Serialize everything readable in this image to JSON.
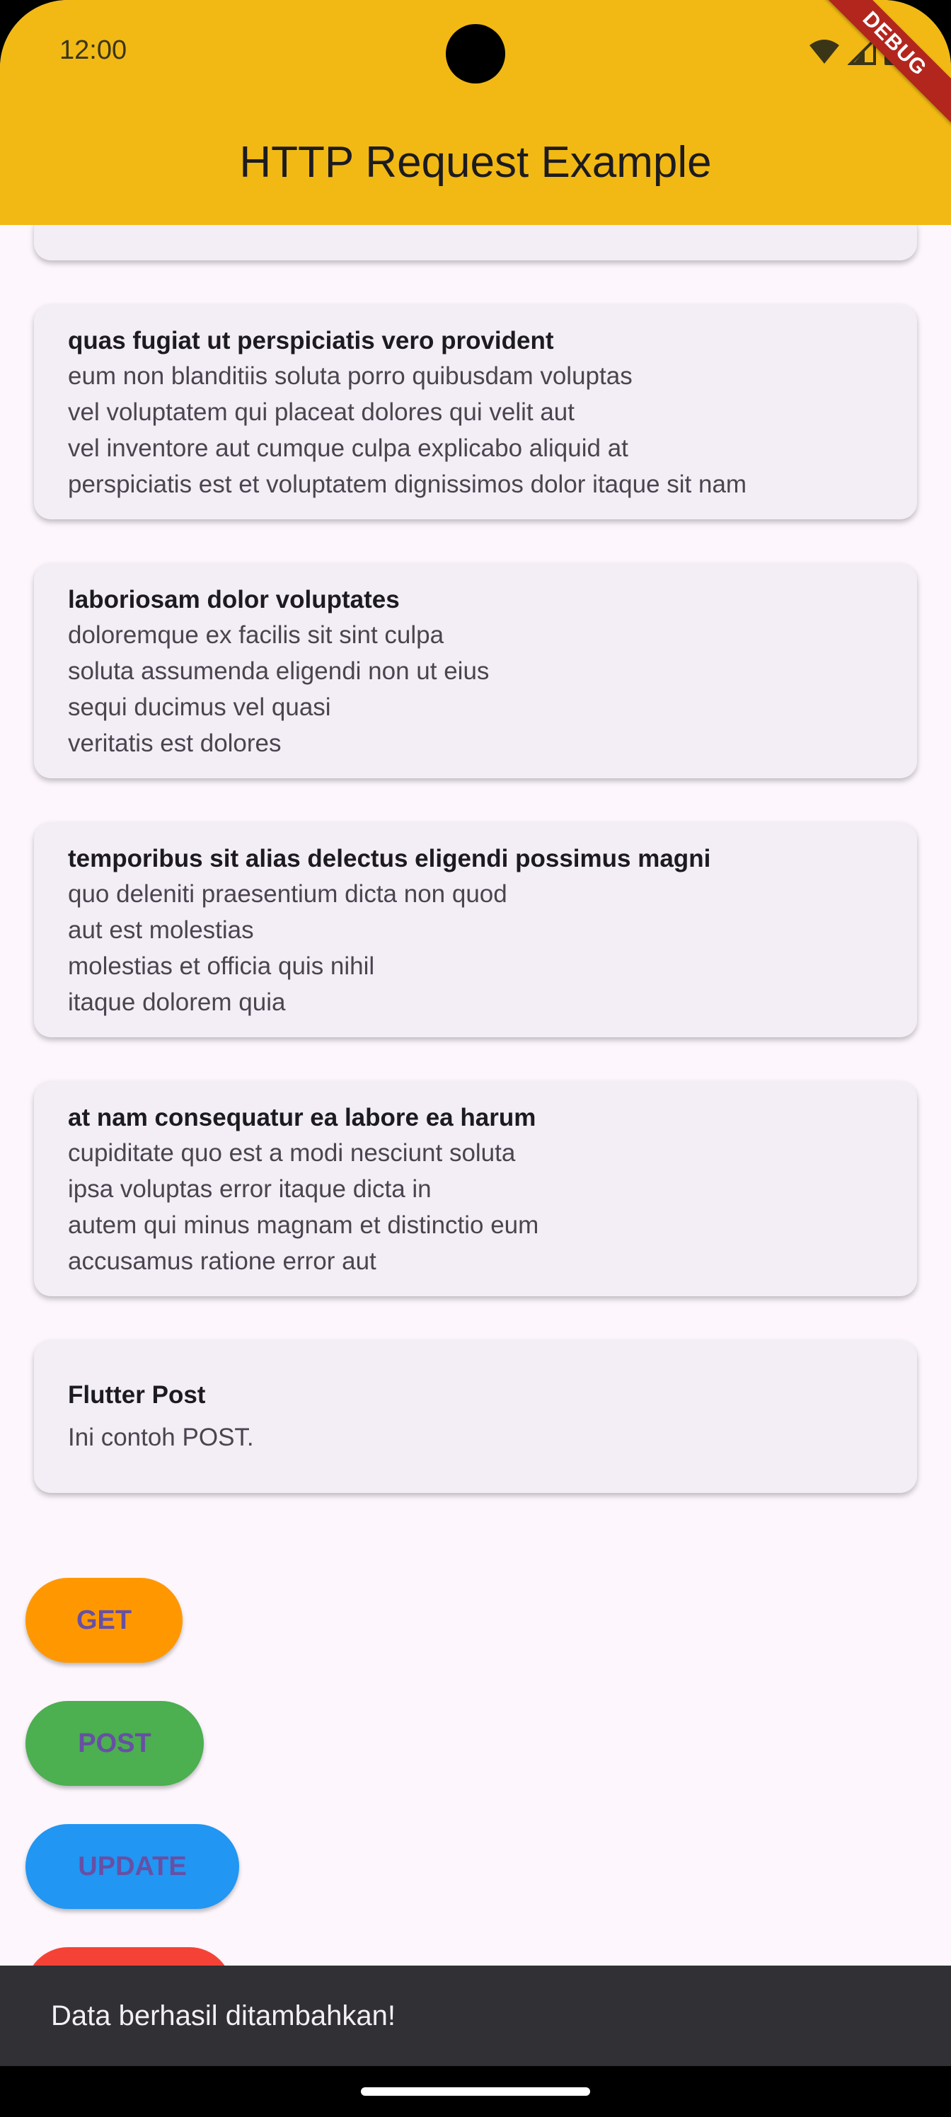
{
  "status_bar": {
    "time": "12:00"
  },
  "app_bar": {
    "title": "HTTP Request Example",
    "debug_banner": "DEBUG"
  },
  "posts": [
    {
      "title": "",
      "body": ""
    },
    {
      "title": "quas fugiat ut perspiciatis vero provident",
      "body": "eum non blanditiis soluta porro quibusdam voluptas\nvel voluptatem qui placeat dolores qui velit aut\nvel inventore aut cumque culpa explicabo aliquid at\nperspiciatis est et voluptatem dignissimos dolor itaque sit nam"
    },
    {
      "title": "laboriosam dolor voluptates",
      "body": "doloremque ex facilis sit sint culpa\nsoluta assumenda eligendi non ut eius\nsequi ducimus vel quasi\nveritatis est dolores"
    },
    {
      "title": "temporibus sit alias delectus eligendi possimus magni",
      "body": "quo deleniti praesentium dicta non quod\naut est molestias\nmolestias et officia quis nihil\nitaque dolorem quia"
    },
    {
      "title": "at nam consequatur ea labore ea harum",
      "body": "cupiditate quo est a modi nesciunt soluta\nipsa voluptas error itaque dicta in\nautem qui minus magnam et distinctio eum\naccusamus ratione error aut"
    },
    {
      "title": "Flutter Post",
      "body": "Ini contoh POST."
    }
  ],
  "buttons": [
    {
      "label": "GET",
      "color": "#ff9800"
    },
    {
      "label": "POST",
      "color": "#4caf50"
    },
    {
      "label": "UPDATE",
      "color": "#2196f3"
    },
    {
      "label": "",
      "color": "#f44336"
    }
  ],
  "snackbar": {
    "message": "Data berhasil ditambahkan!"
  },
  "icons": [
    "wifi-icon",
    "signal-icon",
    "battery-icon"
  ]
}
